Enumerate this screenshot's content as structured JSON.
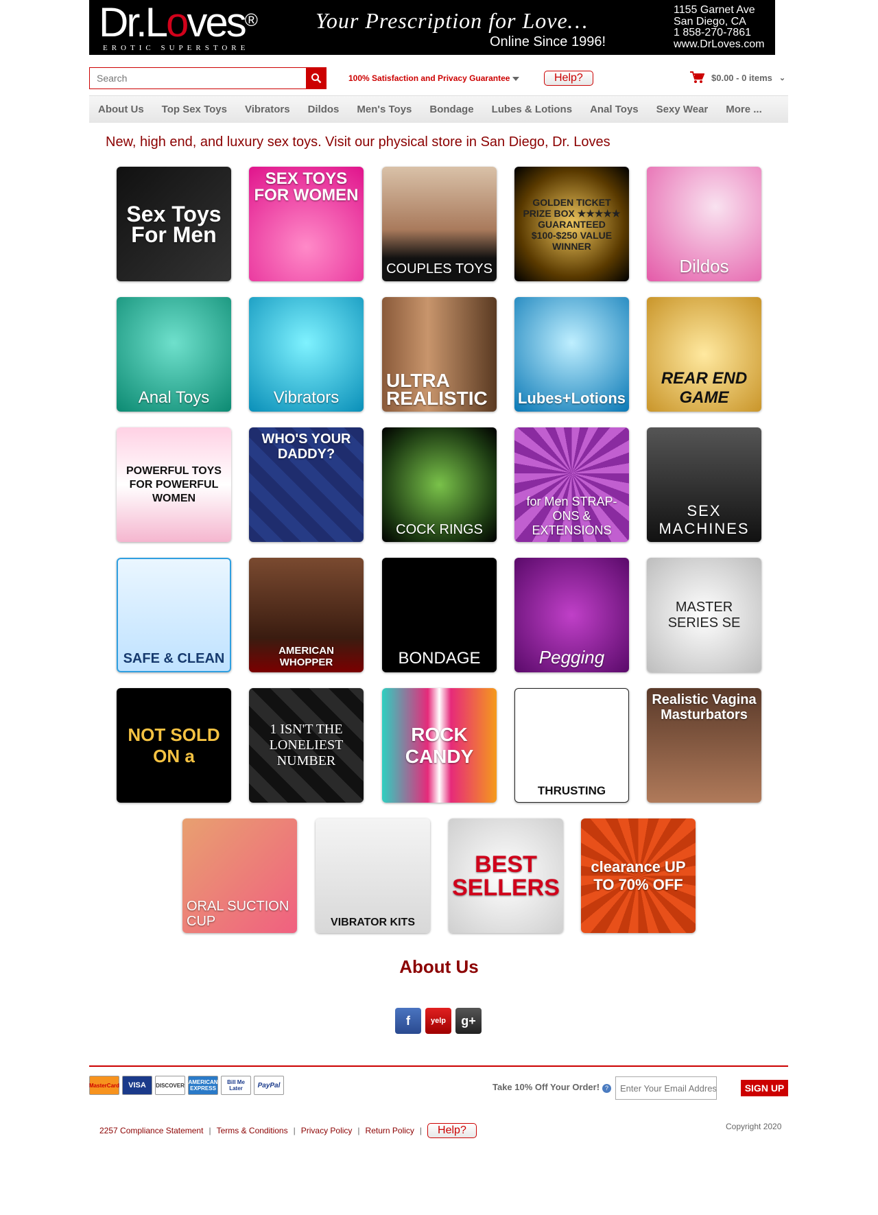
{
  "header": {
    "logo": "Dr.Loves",
    "logo_sub": "EROTIC SUPERSTORE",
    "tagline": "Your Prescription for Love…",
    "online": "Online Since 1996!",
    "address": [
      "1155 Garnet Ave",
      "San Diego, CA",
      "1 858-270-7861",
      "www.DrLoves.com"
    ]
  },
  "search": {
    "placeholder": "Search"
  },
  "guarantee": "100% Satisfaction and Privacy Guarantee",
  "help_label": "Help?",
  "cart": {
    "summary": "$0.00 - 0 items"
  },
  "nav": [
    "About Us",
    "Top Sex Toys",
    "Vibrators",
    "Dildos",
    "Men's Toys",
    "Bondage",
    "Lubes & Lotions",
    "Anal Toys",
    "Sexy Wear",
    "More ..."
  ],
  "headline": "New, high end, and luxury sex toys. Visit our physical store in San Diego, Dr. Loves",
  "tiles": [
    {
      "label": "Sex Toys For Men"
    },
    {
      "label": "SEX TOYS FOR WOMEN"
    },
    {
      "label": "COUPLES TOYS"
    },
    {
      "label": "GOLDEN TICKET PRIZE BOX ★★★★★ GUARANTEED $100-$250 VALUE WINNER"
    },
    {
      "label": "Dildos"
    },
    {
      "label": "Anal Toys"
    },
    {
      "label": "Vibrators"
    },
    {
      "label": "ULTRA REALISTIC"
    },
    {
      "label": "Lubes+Lotions"
    },
    {
      "label": "REAR END GAME"
    },
    {
      "label": "POWERFUL TOYS FOR POWERFUL WOMEN"
    },
    {
      "label": "WHO'S YOUR DADDY?"
    },
    {
      "label": "COCK RINGS"
    },
    {
      "label": "for Men STRAP-ONS & EXTENSIONS"
    },
    {
      "label": "SEX MACHINES"
    },
    {
      "label": "SAFE & CLEAN"
    },
    {
      "label": "AMERICAN WHOPPER"
    },
    {
      "label": "BONDAGE"
    },
    {
      "label": "Pegging"
    },
    {
      "label": "MASTER SERIES SE"
    },
    {
      "label": "NOT SOLD ON a"
    },
    {
      "label": "1 ISN'T THE LONELIEST NUMBER"
    },
    {
      "label": "ROCK CANDY"
    },
    {
      "label": "THRUSTING"
    },
    {
      "label": "Realistic Vagina Masturbators"
    },
    {
      "label": "ORAL SUCTION CUP"
    },
    {
      "label": "VIBRATOR KITS"
    },
    {
      "label": "BEST SELLERS"
    },
    {
      "label": "clearance UP TO 70% OFF"
    }
  ],
  "about_heading": "About Us",
  "social": [
    "facebook-icon",
    "yelp-icon",
    "google-plus-icon"
  ],
  "payment": [
    "MasterCard",
    "VISA",
    "DISCOVER",
    "AMERICAN EXPRESS",
    "Bill Me Later",
    "PayPal"
  ],
  "newsletter": {
    "promo": "Take 10% Off Your Order!",
    "placeholder": "Enter Your Email Address",
    "button": "SIGN UP"
  },
  "footer": {
    "links": [
      "2257 Compliance Statement",
      "Terms & Conditions",
      "Privacy Policy",
      "Return Policy"
    ],
    "copyright": "Copyright 2020"
  },
  "colors": {
    "accent": "#cc0000",
    "heading": "#8b0000"
  }
}
